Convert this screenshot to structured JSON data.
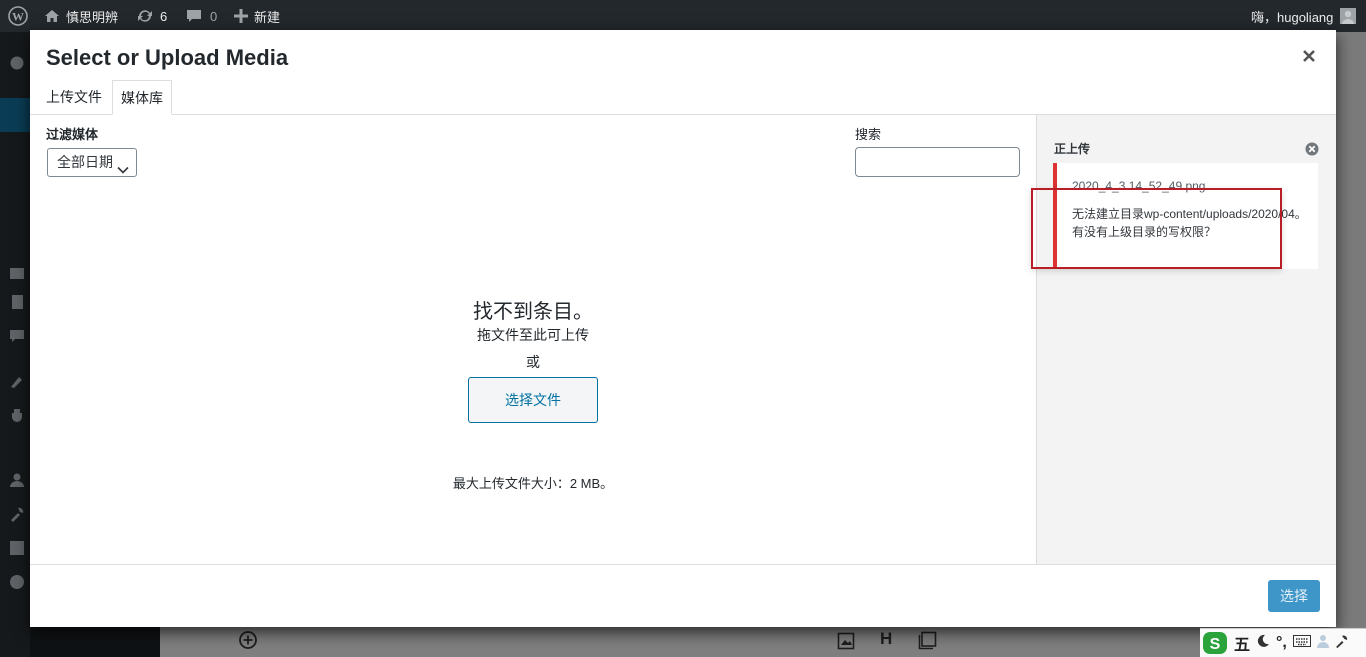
{
  "adminbar": {
    "site_name": "慎思明辨",
    "updates_count": "6",
    "comments_count": "0",
    "new_label": "新建",
    "greeting": "嗨，hugoliang"
  },
  "modal": {
    "title": "Select or Upload Media",
    "tabs": [
      {
        "label": "上传文件",
        "active": false
      },
      {
        "label": "媒体库",
        "active": true
      }
    ],
    "filter": {
      "label": "过滤媒体",
      "selected": "全部日期"
    },
    "search": {
      "label": "搜索",
      "value": "",
      "placeholder": ""
    },
    "empty": {
      "title": "找不到条目。",
      "drag_text": "拖文件至此可上传",
      "or_text": "或",
      "select_files_label": "选择文件",
      "max_size": "最大上传文件大小：2 MB。"
    },
    "sidebar": {
      "uploading_label": "正上传",
      "error": {
        "filename": "2020_4_3 14_52_49.png",
        "message": "无法建立目录wp-content/uploads/2020/04。有没有上级目录的写权限？"
      }
    },
    "action_label": "选择"
  },
  "colors": {
    "accent": "#0071a1",
    "primary_button": "#3d95c8",
    "error": "#dc3232",
    "adminbar_bg": "#23282d"
  },
  "ime": {
    "mode_label": "五"
  }
}
